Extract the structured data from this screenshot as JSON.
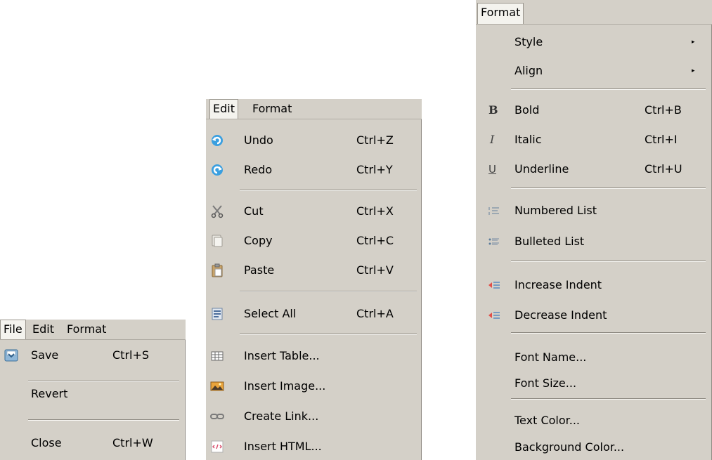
{
  "menu1": {
    "bar": [
      "File",
      "Edit",
      "Format"
    ],
    "items": [
      {
        "label": "Save",
        "shortcut": "Ctrl+S",
        "icon": "save-icon"
      },
      {
        "label": "Revert",
        "shortcut": ""
      },
      {
        "label": "Close",
        "shortcut": "Ctrl+W"
      }
    ]
  },
  "menu2": {
    "bar": [
      "Edit",
      "Format"
    ],
    "items": [
      {
        "label": "Undo",
        "shortcut": "Ctrl+Z",
        "icon": "undo-icon"
      },
      {
        "label": "Redo",
        "shortcut": "Ctrl+Y",
        "icon": "redo-icon"
      },
      {
        "label": "Cut",
        "shortcut": "Ctrl+X",
        "icon": "scissors-icon"
      },
      {
        "label": "Copy",
        "shortcut": "Ctrl+C",
        "icon": "copy-icon"
      },
      {
        "label": "Paste",
        "shortcut": "Ctrl+V",
        "icon": "paste-icon"
      },
      {
        "label": "Select All",
        "shortcut": "Ctrl+A",
        "icon": "select-all-icon"
      },
      {
        "label": "Insert Table...",
        "icon": "table-icon"
      },
      {
        "label": "Insert Image...",
        "icon": "image-icon"
      },
      {
        "label": "Create Link...",
        "icon": "link-icon"
      },
      {
        "label": "Insert HTML...",
        "icon": "html-icon"
      }
    ]
  },
  "menu3": {
    "bar": [
      "Format"
    ],
    "items": [
      {
        "label": "Style",
        "submenu": "▸"
      },
      {
        "label": "Align",
        "submenu": "▸"
      },
      {
        "label": "Bold",
        "shortcut": "Ctrl+B",
        "icon": "bold-icon",
        "glyph": "B"
      },
      {
        "label": "Italic",
        "shortcut": "Ctrl+I",
        "icon": "italic-icon",
        "glyph": "I"
      },
      {
        "label": "Underline",
        "shortcut": "Ctrl+U",
        "icon": "underline-icon",
        "glyph": "U"
      },
      {
        "label": "Numbered List",
        "icon": "numbered-list-icon"
      },
      {
        "label": "Bulleted List",
        "icon": "bulleted-list-icon"
      },
      {
        "label": "Increase Indent",
        "icon": "increase-indent-icon"
      },
      {
        "label": "Decrease Indent",
        "icon": "decrease-indent-icon"
      },
      {
        "label": "Font Name..."
      },
      {
        "label": "Font Size..."
      },
      {
        "label": "Text Color..."
      },
      {
        "label": "Background Color..."
      }
    ]
  }
}
